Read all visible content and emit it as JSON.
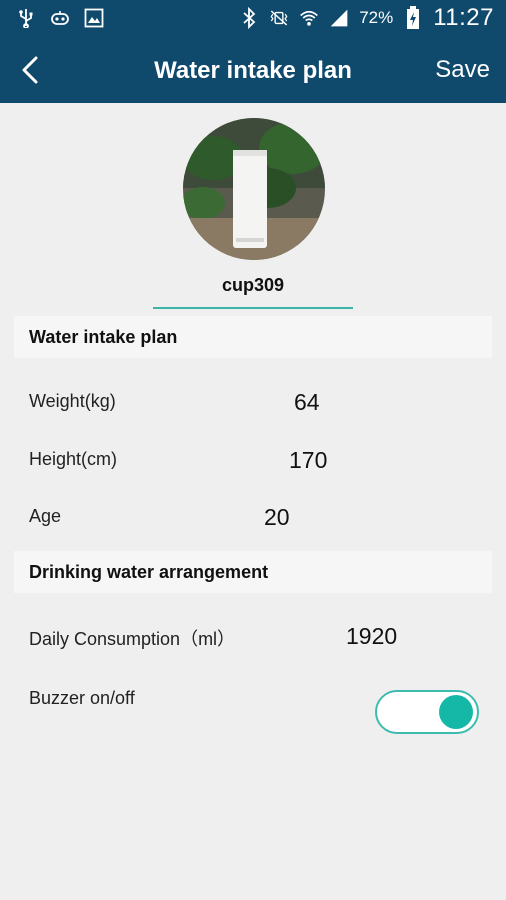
{
  "status_bar": {
    "battery": "72%",
    "time": "11:27",
    "icons": [
      "usb-icon",
      "game-controller-icon",
      "image-icon",
      "bluetooth-icon",
      "vibrate-icon",
      "wifi-icon",
      "signal-icon",
      "battery-charging-icon"
    ]
  },
  "header": {
    "title": "Water intake plan",
    "save_label": "Save",
    "back_icon": "chevron-left-icon"
  },
  "profile": {
    "device_name": "cup309"
  },
  "plan": {
    "section_title": "Water intake plan",
    "weight_label": "Weight(kg)",
    "weight_value": "64",
    "height_label": "Height(cm)",
    "height_value": "170",
    "age_label": "Age",
    "age_value": "20"
  },
  "arrangement": {
    "section_title": "Drinking water arrangement",
    "daily_label": "Daily Consumption（ml）",
    "daily_value": "1920",
    "buzzer_label": "Buzzer on/off",
    "buzzer_on": true
  },
  "colors": {
    "header_bg": "#0f4a6d",
    "accent": "#15b7a7",
    "background": "#efefef"
  }
}
